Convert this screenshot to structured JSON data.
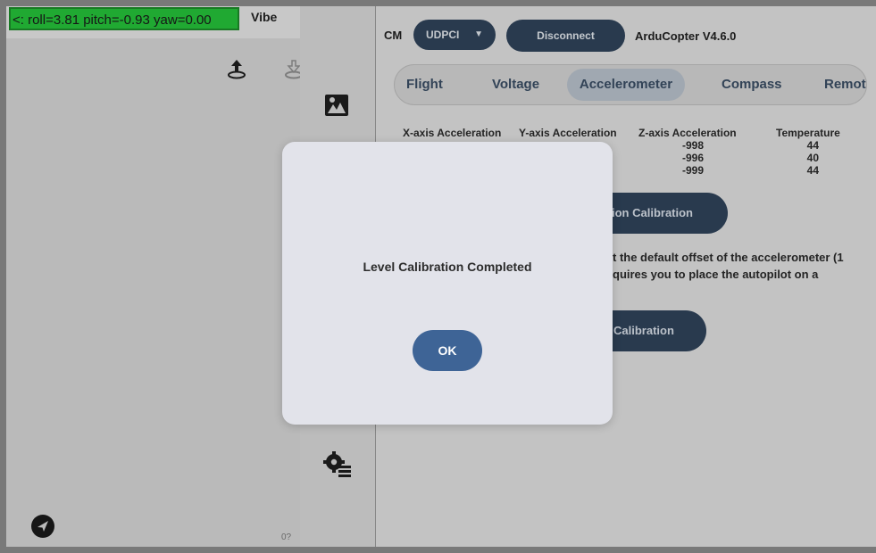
{
  "status": {
    "attitude": "<: roll=3.81 pitch=-0.93 yaw=0.00",
    "vibe": "Vibe",
    "scale": "0?"
  },
  "connection": {
    "link_label": "CM",
    "port": "UDPCI",
    "port_caret": "▼",
    "disconnect": "Disconnect",
    "firmware": "ArduCopter V4.6.0"
  },
  "tabs": [
    {
      "label": "Flight"
    },
    {
      "label": "Voltage"
    },
    {
      "label": "Accelerometer"
    },
    {
      "label": "Compass"
    },
    {
      "label": "Remot"
    }
  ],
  "accel_table": {
    "headers": [
      "X-axis Acceleration",
      "Y-axis Acceleration",
      "Z-axis Acceleration",
      "Temperature"
    ],
    "z_values": [
      "-998",
      "-996",
      "-999"
    ],
    "temp_values": [
      "44",
      "40",
      "44"
    ]
  },
  "accel_calibration": {
    "label": "ion Calibration"
  },
  "level_description": {
    "line1": "t the default offset of the accelerometer (1",
    "line2": "quires you to place the autopilot on a"
  },
  "level_calibration": {
    "label": "Calibration"
  },
  "dialog": {
    "message": "Level Calibration Completed",
    "ok": "OK"
  },
  "colors": {
    "accent": "#3e6496",
    "button_dark": "#2f4259",
    "attitude_bg": "#25c13a"
  },
  "icons": {
    "upload": "upload-icon",
    "download": "download-icon",
    "navigate": "navigation-arrow-icon",
    "vehicle": "vehicle-photo-icon",
    "settings": "settings-gear-icon"
  }
}
